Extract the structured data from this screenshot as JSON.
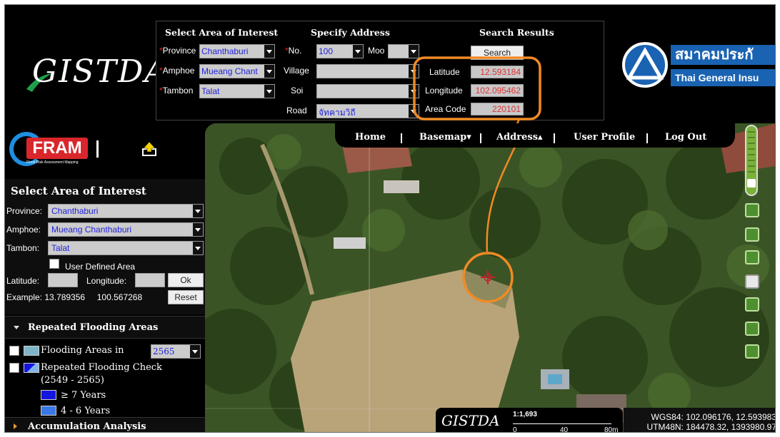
{
  "brand": {
    "gistda_text": "GISTDA",
    "fram_text": "FRAM",
    "fram_sub": "Flood Risk Assessment Mapping",
    "insurer_thai": "สมาคมประกั",
    "insurer_eng": "Thai General Insu"
  },
  "search_panel": {
    "headers": [
      "Select Area of Interest",
      "Specify Address",
      "Search Results"
    ],
    "province_label": "Province",
    "province_value": "Chanthaburi",
    "amphoe_label": "Amphoe",
    "amphoe_value": "Mueang Chant",
    "tambon_label": "Tambon",
    "tambon_value": "Talat",
    "no_label": "No.",
    "no_value": "100",
    "moo_label": "Moo",
    "moo_value": "",
    "village_label": "Village",
    "soi_label": "Soi",
    "road_label": "Road",
    "road_value": "จัทคามวิถี",
    "search_button": "Search",
    "latitude_label": "Latitude",
    "latitude_value": "12.593184",
    "longitude_label": "Longitude",
    "longitude_value": "102.095462",
    "areacode_label": "Area Code",
    "areacode_value": "220101",
    "required_mark": "*"
  },
  "nav": {
    "home": "Home",
    "basemap": "Basemap▾",
    "address": "Address▴",
    "user_profile": "User Profile",
    "logout": "Log Out",
    "sep": "|"
  },
  "left_panel": {
    "title": "Select Area of Interest",
    "province_label": "Province:",
    "province_value": "Chanthaburi",
    "amphoe_label": "Amphoe:",
    "amphoe_value": "Mueang Chanthaburi",
    "tambon_label": "Tambon:",
    "tambon_value": "Talat",
    "user_defined": "User Defined Area",
    "latitude_label": "Latitude:",
    "longitude_label": "Longitude:",
    "ok_button": "Ok",
    "example": "Example: 13.789356     100.567268",
    "reset_button": "Reset",
    "repeated_title": "Repeated Flooding Areas",
    "flooding_areas_in": "Flooding Areas in",
    "year_value": "2565",
    "repeated_check": "Repeated Flooding Check",
    "range": "(2549 - 2565)",
    "legend": [
      {
        "label": "≥ 7 Years",
        "color": "#1515e0"
      },
      {
        "label": "4 - 6 Years",
        "color": "#3a78e8"
      }
    ],
    "accumulation_title": "Accumulation Analysis"
  },
  "map": {
    "scale_label": "1:1,693",
    "scale_ticks": [
      "0",
      "40",
      "80m"
    ],
    "wgs84": "WGS84: 102.096176, 12.593983",
    "utm": "UTM48N: 184478.32, 1393980.97",
    "accent_orange": "#f08a24"
  }
}
